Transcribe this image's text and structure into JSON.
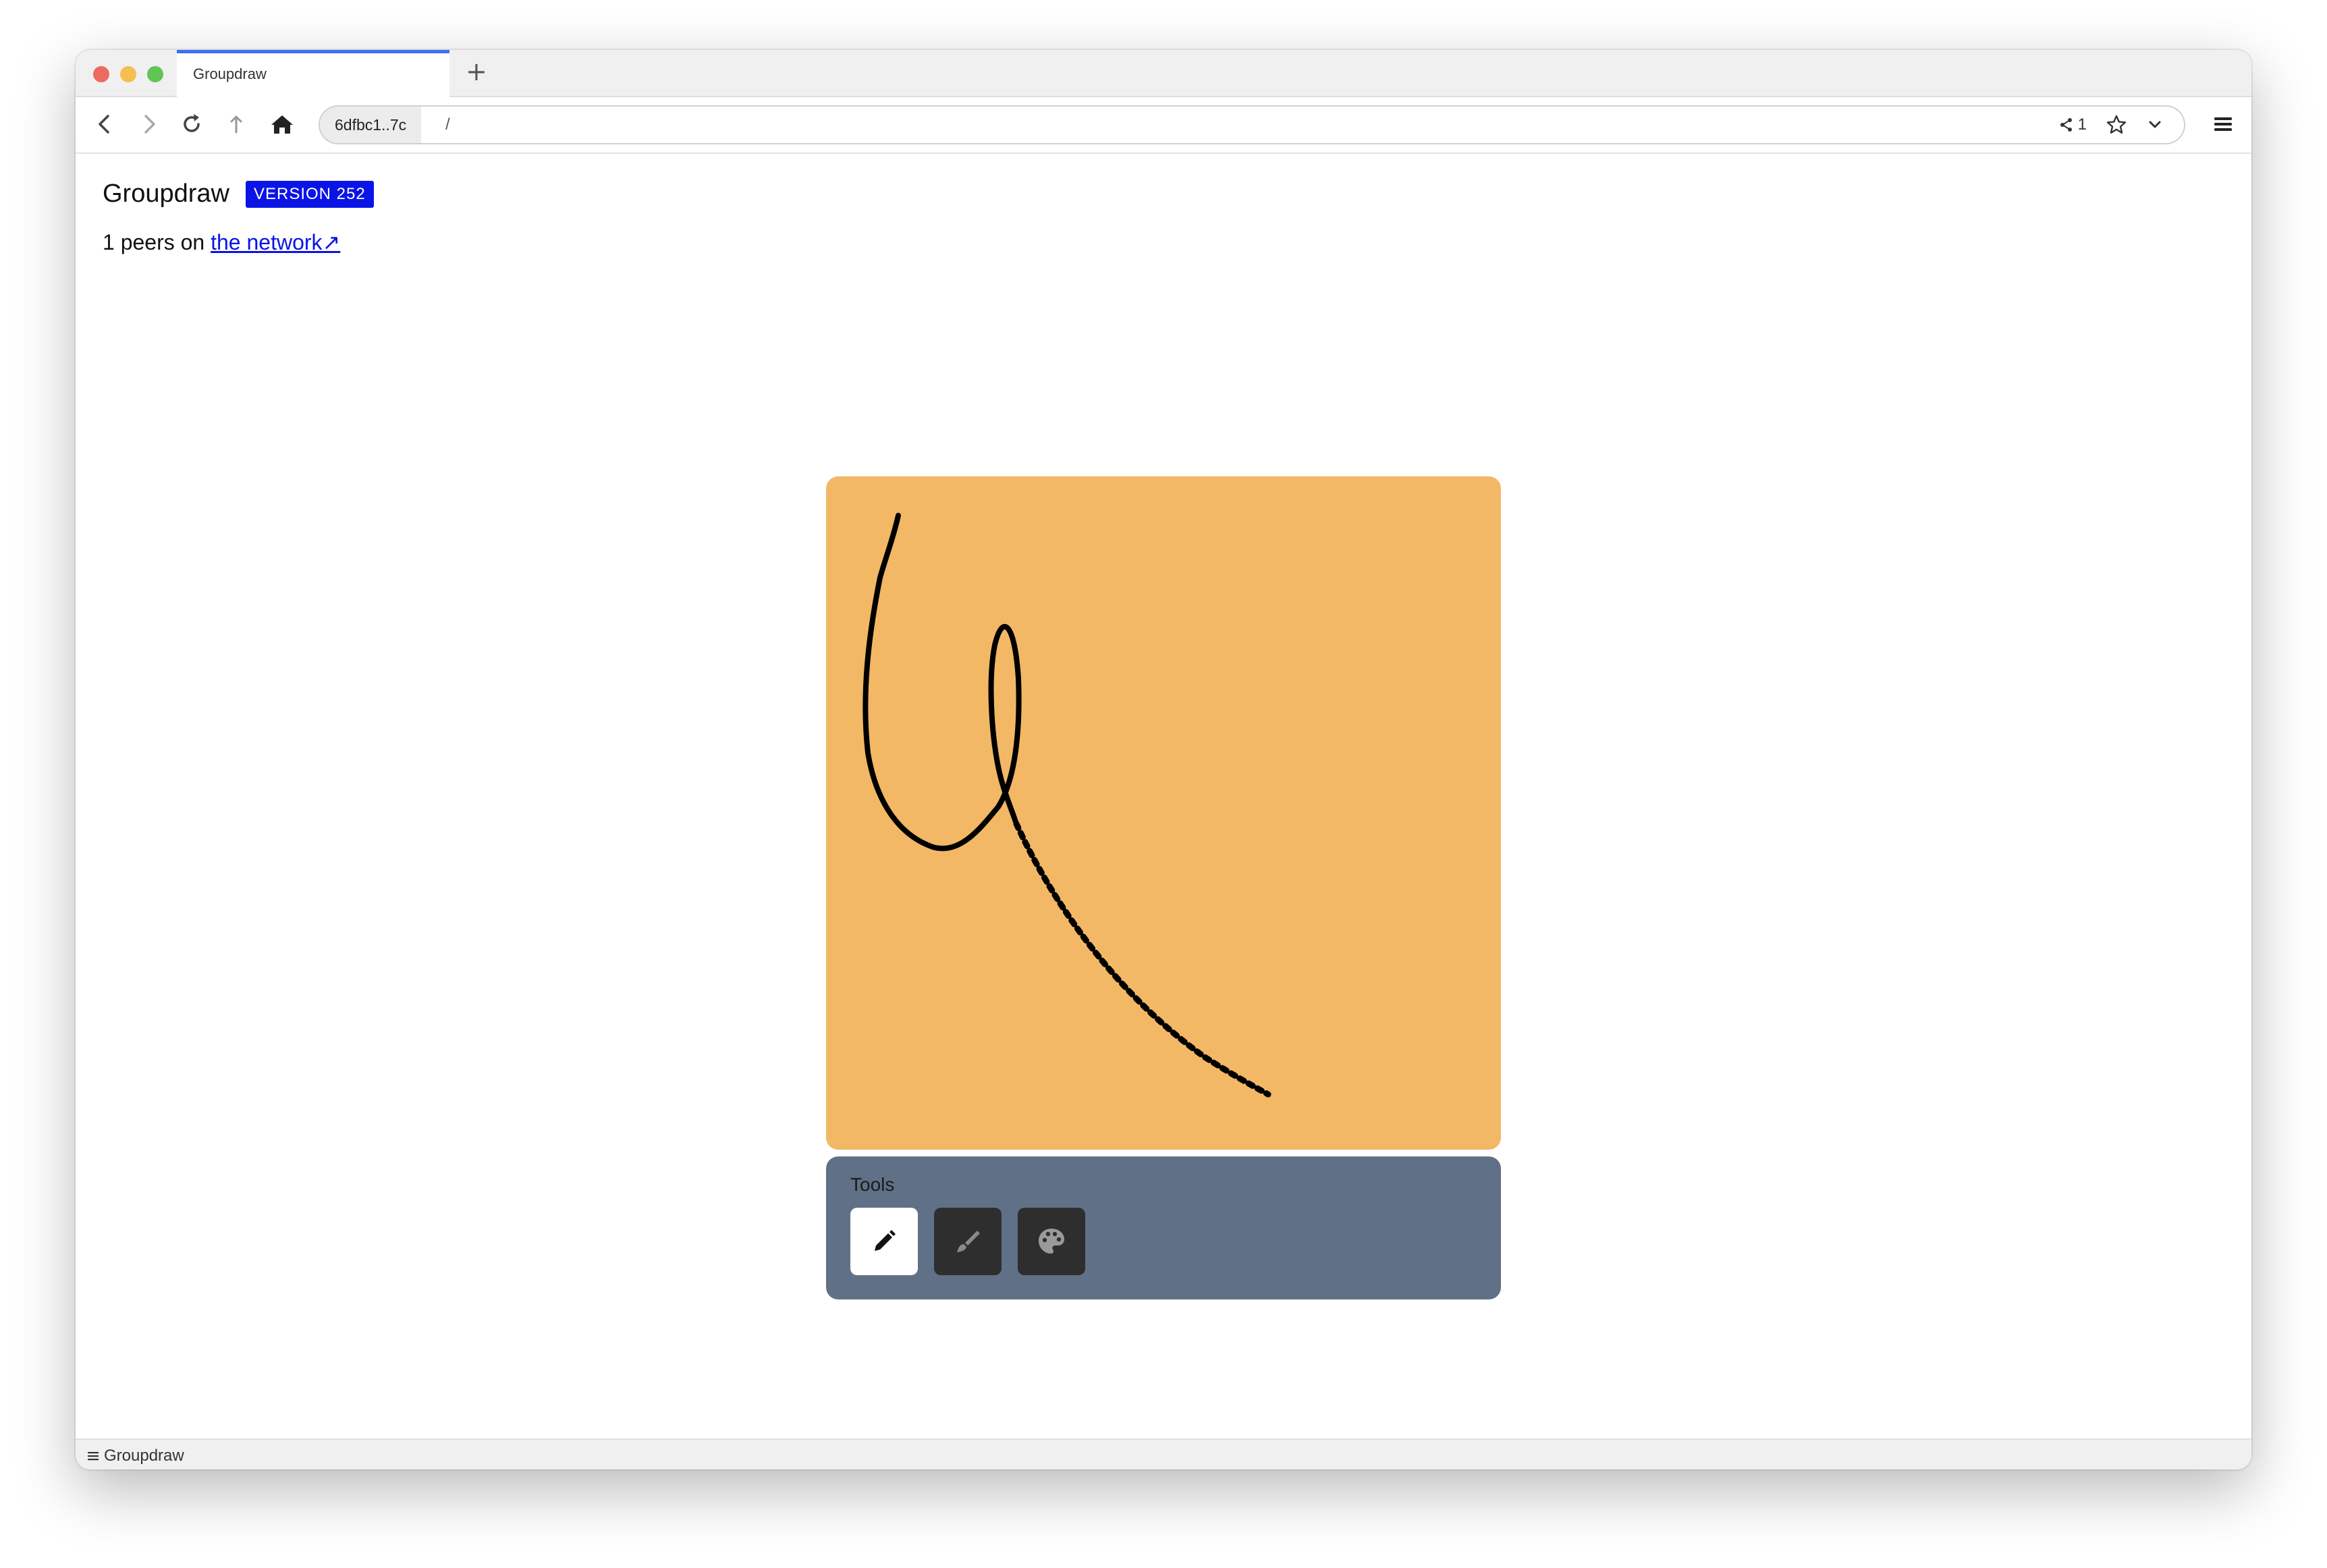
{
  "browser": {
    "tab_title": "Groupdraw",
    "new_tab_label": "+",
    "url_key": "6dfbc1..7c",
    "url_path": "/",
    "share_count": "1"
  },
  "app": {
    "title": "Groupdraw",
    "version_badge": "VERSION 252",
    "peers_prefix": "1 peers on ",
    "network_link": "the network↗"
  },
  "canvas": {
    "background": "#f2b865",
    "stroke_color": "#000000"
  },
  "tools": {
    "label": "Tools",
    "items": [
      {
        "name": "pencil",
        "active": true
      },
      {
        "name": "brush",
        "active": false
      },
      {
        "name": "palette",
        "active": false
      }
    ]
  },
  "status": {
    "label": "Groupdraw"
  },
  "colors": {
    "accent": "#0a14e6",
    "tab_indicator": "#3b6ef6",
    "tools_panel": "#607086"
  }
}
